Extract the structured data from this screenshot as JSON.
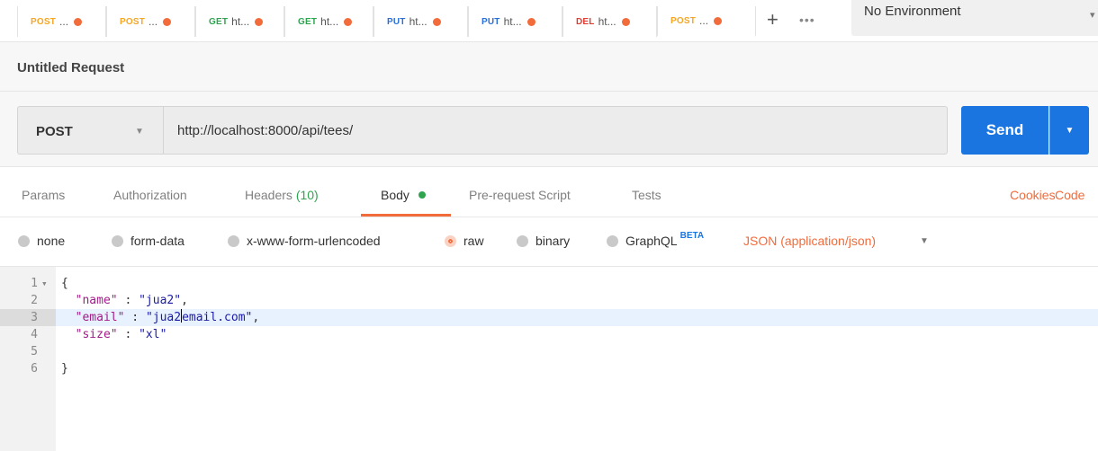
{
  "tabs": [
    {
      "method": "POST",
      "name": "...",
      "method_class": "m-post"
    },
    {
      "method": "POST",
      "name": "...",
      "method_class": "m-post"
    },
    {
      "method": "GET",
      "name": "ht...",
      "method_class": "m-get"
    },
    {
      "method": "GET",
      "name": "ht...",
      "method_class": "m-get"
    },
    {
      "method": "PUT",
      "name": "ht...",
      "method_class": "m-put"
    },
    {
      "method": "PUT",
      "name": "ht...",
      "method_class": "m-put"
    },
    {
      "method": "DEL",
      "name": "ht...",
      "method_class": "m-del"
    },
    {
      "method": "POST",
      "name": "...",
      "method_class": "m-post"
    }
  ],
  "tab_controls": {
    "add": "+",
    "more": "•••"
  },
  "environment": {
    "selected": "No Environment"
  },
  "request": {
    "name": "Untitled Request",
    "method": "POST",
    "url": "http://localhost:8000/api/tees/",
    "send_label": "Send"
  },
  "request_tabs": {
    "params": "Params",
    "authorization": "Authorization",
    "headers": "Headers",
    "headers_count": "(10)",
    "body": "Body",
    "prerequest": "Pre-request Script",
    "tests": "Tests",
    "cookies": "Cookies",
    "code": "Code"
  },
  "body_types": {
    "none": "none",
    "form_data": "form-data",
    "urlencoded": "x-www-form-urlencoded",
    "raw": "raw",
    "binary": "binary",
    "graphql": "GraphQL",
    "graphql_badge": "BETA",
    "selected": "raw",
    "content_type": "JSON (application/json)"
  },
  "editor": {
    "line_numbers": [
      "1",
      "2",
      "3",
      "4",
      "5",
      "6"
    ],
    "fold_marker": "▾",
    "active_line": 3,
    "lines": {
      "l1": "{",
      "l2_key": "\"name\"",
      "l2_sep": " : ",
      "l2_val": "\"jua2\"",
      "l2_end": ",",
      "l3_key": "\"email\"",
      "l3_sep": " : ",
      "l3_val_a": "\"jua2",
      "l3_val_b": "email.com\"",
      "l3_end": ",",
      "l4_key": "\"size\"",
      "l4_sep": " : ",
      "l4_val": "\"xl\"",
      "l6": "}"
    }
  },
  "colors": {
    "accent": "#f26b3a",
    "send": "#1a75e0",
    "get": "#2ea44f",
    "put": "#2b6fd6",
    "del": "#e03c31",
    "post": "#f5a623"
  }
}
